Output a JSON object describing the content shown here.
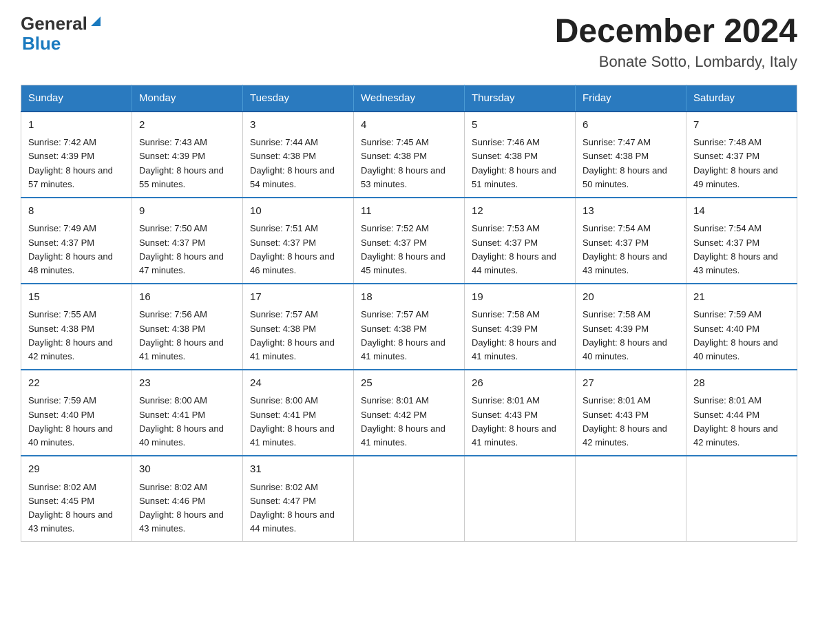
{
  "header": {
    "logo_general": "General",
    "logo_blue": "Blue",
    "title": "December 2024",
    "subtitle": "Bonate Sotto, Lombardy, Italy"
  },
  "weekdays": [
    "Sunday",
    "Monday",
    "Tuesday",
    "Wednesday",
    "Thursday",
    "Friday",
    "Saturday"
  ],
  "weeks": [
    [
      {
        "day": "1",
        "sunrise": "7:42 AM",
        "sunset": "4:39 PM",
        "daylight": "8 hours and 57 minutes."
      },
      {
        "day": "2",
        "sunrise": "7:43 AM",
        "sunset": "4:39 PM",
        "daylight": "8 hours and 55 minutes."
      },
      {
        "day": "3",
        "sunrise": "7:44 AM",
        "sunset": "4:38 PM",
        "daylight": "8 hours and 54 minutes."
      },
      {
        "day": "4",
        "sunrise": "7:45 AM",
        "sunset": "4:38 PM",
        "daylight": "8 hours and 53 minutes."
      },
      {
        "day": "5",
        "sunrise": "7:46 AM",
        "sunset": "4:38 PM",
        "daylight": "8 hours and 51 minutes."
      },
      {
        "day": "6",
        "sunrise": "7:47 AM",
        "sunset": "4:38 PM",
        "daylight": "8 hours and 50 minutes."
      },
      {
        "day": "7",
        "sunrise": "7:48 AM",
        "sunset": "4:37 PM",
        "daylight": "8 hours and 49 minutes."
      }
    ],
    [
      {
        "day": "8",
        "sunrise": "7:49 AM",
        "sunset": "4:37 PM",
        "daylight": "8 hours and 48 minutes."
      },
      {
        "day": "9",
        "sunrise": "7:50 AM",
        "sunset": "4:37 PM",
        "daylight": "8 hours and 47 minutes."
      },
      {
        "day": "10",
        "sunrise": "7:51 AM",
        "sunset": "4:37 PM",
        "daylight": "8 hours and 46 minutes."
      },
      {
        "day": "11",
        "sunrise": "7:52 AM",
        "sunset": "4:37 PM",
        "daylight": "8 hours and 45 minutes."
      },
      {
        "day": "12",
        "sunrise": "7:53 AM",
        "sunset": "4:37 PM",
        "daylight": "8 hours and 44 minutes."
      },
      {
        "day": "13",
        "sunrise": "7:54 AM",
        "sunset": "4:37 PM",
        "daylight": "8 hours and 43 minutes."
      },
      {
        "day": "14",
        "sunrise": "7:54 AM",
        "sunset": "4:37 PM",
        "daylight": "8 hours and 43 minutes."
      }
    ],
    [
      {
        "day": "15",
        "sunrise": "7:55 AM",
        "sunset": "4:38 PM",
        "daylight": "8 hours and 42 minutes."
      },
      {
        "day": "16",
        "sunrise": "7:56 AM",
        "sunset": "4:38 PM",
        "daylight": "8 hours and 41 minutes."
      },
      {
        "day": "17",
        "sunrise": "7:57 AM",
        "sunset": "4:38 PM",
        "daylight": "8 hours and 41 minutes."
      },
      {
        "day": "18",
        "sunrise": "7:57 AM",
        "sunset": "4:38 PM",
        "daylight": "8 hours and 41 minutes."
      },
      {
        "day": "19",
        "sunrise": "7:58 AM",
        "sunset": "4:39 PM",
        "daylight": "8 hours and 41 minutes."
      },
      {
        "day": "20",
        "sunrise": "7:58 AM",
        "sunset": "4:39 PM",
        "daylight": "8 hours and 40 minutes."
      },
      {
        "day": "21",
        "sunrise": "7:59 AM",
        "sunset": "4:40 PM",
        "daylight": "8 hours and 40 minutes."
      }
    ],
    [
      {
        "day": "22",
        "sunrise": "7:59 AM",
        "sunset": "4:40 PM",
        "daylight": "8 hours and 40 minutes."
      },
      {
        "day": "23",
        "sunrise": "8:00 AM",
        "sunset": "4:41 PM",
        "daylight": "8 hours and 40 minutes."
      },
      {
        "day": "24",
        "sunrise": "8:00 AM",
        "sunset": "4:41 PM",
        "daylight": "8 hours and 41 minutes."
      },
      {
        "day": "25",
        "sunrise": "8:01 AM",
        "sunset": "4:42 PM",
        "daylight": "8 hours and 41 minutes."
      },
      {
        "day": "26",
        "sunrise": "8:01 AM",
        "sunset": "4:43 PM",
        "daylight": "8 hours and 41 minutes."
      },
      {
        "day": "27",
        "sunrise": "8:01 AM",
        "sunset": "4:43 PM",
        "daylight": "8 hours and 42 minutes."
      },
      {
        "day": "28",
        "sunrise": "8:01 AM",
        "sunset": "4:44 PM",
        "daylight": "8 hours and 42 minutes."
      }
    ],
    [
      {
        "day": "29",
        "sunrise": "8:02 AM",
        "sunset": "4:45 PM",
        "daylight": "8 hours and 43 minutes."
      },
      {
        "day": "30",
        "sunrise": "8:02 AM",
        "sunset": "4:46 PM",
        "daylight": "8 hours and 43 minutes."
      },
      {
        "day": "31",
        "sunrise": "8:02 AM",
        "sunset": "4:47 PM",
        "daylight": "8 hours and 44 minutes."
      },
      null,
      null,
      null,
      null
    ]
  ]
}
